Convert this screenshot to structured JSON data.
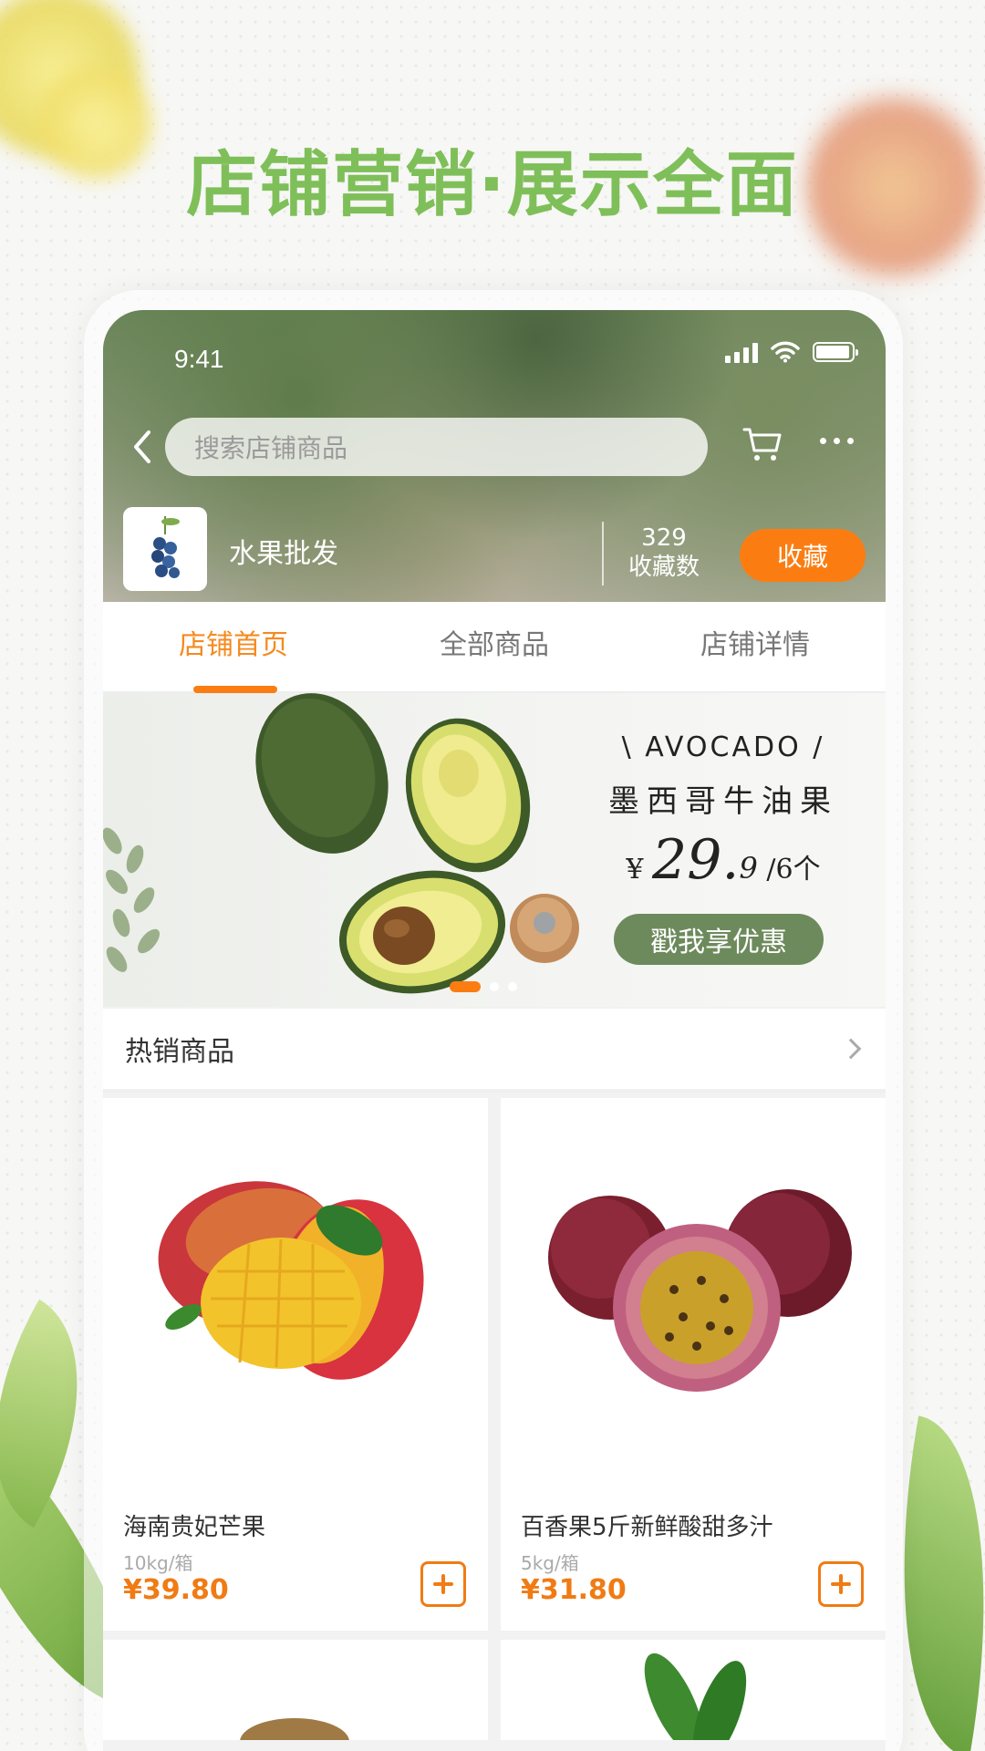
{
  "promo": {
    "title": "店铺营销·展示全面"
  },
  "status_bar": {
    "time": "9:41"
  },
  "header": {
    "search_placeholder": "搜索店铺商品",
    "store_name": "水果批发",
    "favorites_count": "329",
    "favorites_label": "收藏数",
    "favorite_button": "收藏"
  },
  "tabs": [
    {
      "label": "店铺首页",
      "active": true
    },
    {
      "label": "全部商品",
      "active": false
    },
    {
      "label": "店铺详情",
      "active": false
    }
  ],
  "banner": {
    "title_en": "\\ AVOCADO /",
    "title_cn": "墨西哥牛油果",
    "currency": "¥",
    "price_main": "29.",
    "price_decimal": "9",
    "price_unit": "/6个",
    "promo_button": "戳我享优惠",
    "slides": 3,
    "active_slide": 0
  },
  "hot_section": {
    "title": "热销商品"
  },
  "products": [
    {
      "name": "海南贵妃芒果",
      "spec": "10kg/箱",
      "price": "¥39.80"
    },
    {
      "name": "百香果5斤新鲜酸甜多汁",
      "spec": "5kg/箱",
      "price": "¥31.80"
    }
  ],
  "colors": {
    "accent": "#fb7d12",
    "promo_green": "#7fbf59",
    "banner_button": "#6d8a5c"
  }
}
